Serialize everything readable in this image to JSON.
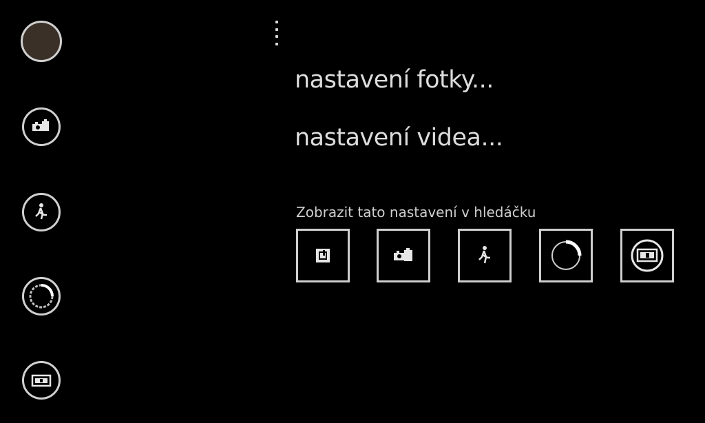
{
  "menu": {
    "photo_settings": "nastavení fotky...",
    "video_settings": "nastavení videa..."
  },
  "viewfinder_section": {
    "label": "Zobrazit tato nastavení v hledáčku"
  },
  "left_rail": {
    "buttons": [
      "shutter-button",
      "burst-mode-icon",
      "scene-mode-icon",
      "exposure-icon",
      "camera-switch-icon"
    ]
  },
  "shortcuts": {
    "icons": [
      "flash-icon",
      "burst-mode-icon",
      "scene-mode-icon",
      "exposure-icon",
      "camera-switch-icon"
    ]
  },
  "colors": {
    "background": "#000000",
    "foreground": "#d9d9d9",
    "shutter_fill": "#3a3028"
  }
}
